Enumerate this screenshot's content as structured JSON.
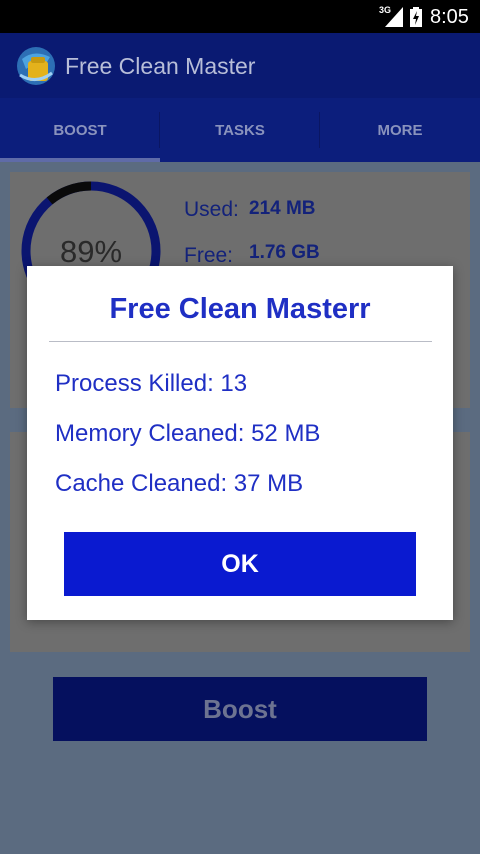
{
  "status_bar": {
    "network": "3G",
    "time": "8:05",
    "signal_icon": "cell-signal-icon",
    "battery_icon": "battery-charging-icon"
  },
  "app_bar": {
    "title": "Free Clean Master",
    "logo_icon": "app-logo-icon"
  },
  "tabs": [
    {
      "label": "BOOST",
      "selected": true
    },
    {
      "label": "TASKS",
      "selected": false
    },
    {
      "label": "MORE",
      "selected": false
    }
  ],
  "memory": {
    "percent": "89%",
    "percent_value": 0.89,
    "used_label": "Used:",
    "used_value": "214 MB",
    "free_label": "Free:",
    "free_value": "1.76 GB"
  },
  "boost_button": "Boost",
  "dialog": {
    "title": "Free Clean Masterr",
    "lines": [
      "Process Killed: 13",
      "Memory Cleaned: 52 MB",
      "Cache Cleaned: 37 MB"
    ],
    "ok_label": "OK"
  },
  "colors": {
    "app_bar": "#0a1a72",
    "tabs": "#0c1e7c",
    "dialog_text": "#1f2fc4",
    "ok_button": "#0a1ad0",
    "overlay_bg": "#5b6b80"
  }
}
